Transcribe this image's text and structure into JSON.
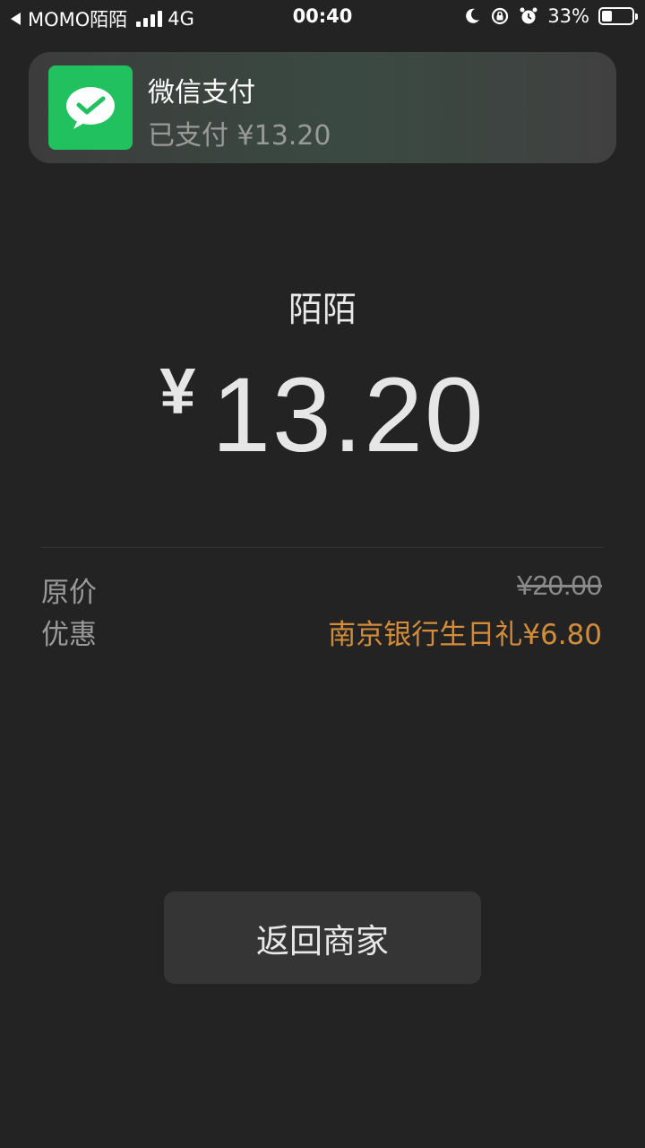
{
  "status_bar": {
    "back_app": "MOMO陌陌",
    "network": "4G",
    "time": "00:40",
    "battery_percent": "33%",
    "battery_level": 0.33
  },
  "notification": {
    "app_name": "微信支付",
    "message": "已支付 ¥13.20",
    "icon": "wechat-pay-icon",
    "icon_color": "#21c15f"
  },
  "payment": {
    "merchant": "陌陌",
    "currency_symbol": "¥",
    "amount": "13.20"
  },
  "details": {
    "original_label": "原价",
    "original_value": "¥20.00",
    "discount_label": "优惠",
    "discount_value": "南京银行生日礼¥6.80"
  },
  "actions": {
    "return_label": "返回商家"
  },
  "colors": {
    "background": "#232323",
    "discount": "#d38d3a"
  }
}
